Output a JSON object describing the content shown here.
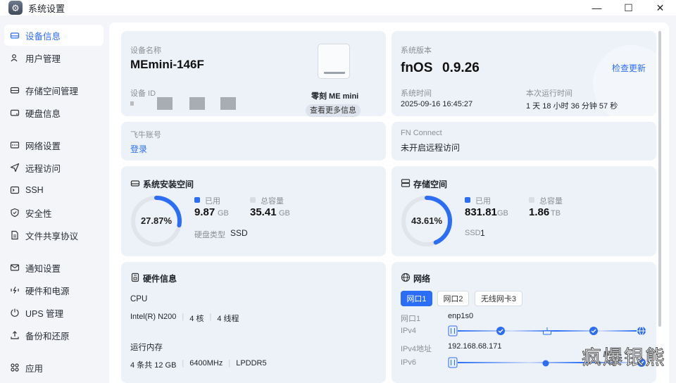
{
  "window": {
    "title": "系统设置",
    "controls": {
      "minimize": "—",
      "maximize": "☐",
      "close": "✕"
    }
  },
  "sidebar": {
    "items": [
      {
        "label": "设备信息",
        "icon": "hard-drive-icon",
        "active": true
      },
      {
        "label": "用户管理",
        "icon": "users-icon"
      },
      {
        "label": "存储空间管理",
        "icon": "storage-icon"
      },
      {
        "label": "硬盘信息",
        "icon": "disk-icon"
      },
      {
        "label": "网络设置",
        "icon": "network-icon"
      },
      {
        "label": "远程访问",
        "icon": "send-icon"
      },
      {
        "label": "SSH",
        "icon": "terminal-icon"
      },
      {
        "label": "安全性",
        "icon": "shield-icon"
      },
      {
        "label": "文件共享协议",
        "icon": "file-icon"
      },
      {
        "label": "通知设置",
        "icon": "mail-icon"
      },
      {
        "label": "硬件和电源",
        "icon": "power-icon"
      },
      {
        "label": "UPS 管理",
        "icon": "ups-icon"
      },
      {
        "label": "备份和还原",
        "icon": "backup-icon"
      },
      {
        "label": "应用",
        "icon": "apps-icon"
      }
    ]
  },
  "device": {
    "name_label": "设备名称",
    "name": "MEmini-146F",
    "id_label": "设备 ID",
    "model": "零刻 ME mini",
    "more_button": "查看更多信息"
  },
  "system": {
    "version_label": "系统版本",
    "os": "fnOS",
    "version": "0.9.26",
    "check_update": "检查更新",
    "time_label": "系统时间",
    "time": "2025-09-16 16:45:27",
    "uptime_label": "本次运行时间",
    "uptime": "1 天 18 小时 36 分钟 57 秒"
  },
  "account": {
    "label": "飞牛账号",
    "login": "登录"
  },
  "fnconnect": {
    "label": "FN Connect",
    "status": "未开启远程访问"
  },
  "system_space": {
    "title": "系统安装空间",
    "percent": "27.87%",
    "percent_value": 27.87,
    "used_label": "已用",
    "used": "9.87",
    "used_unit": "GB",
    "total_label": "总容量",
    "total": "35.41",
    "total_unit": "GB",
    "disk_type_label": "硬盘类型",
    "disk_type": "SSD"
  },
  "storage": {
    "title": "存储空间",
    "percent": "43.61%",
    "percent_value": 43.61,
    "used_label": "已用",
    "used": "831.81",
    "used_unit": "GB",
    "total_label": "总容量",
    "total": "1.86",
    "total_unit": "TB",
    "ssd_label": "SSD",
    "ssd_count": "1"
  },
  "hardware": {
    "title": "硬件信息",
    "cpu_label": "CPU",
    "cpu_model": "Intel(R) N200",
    "cpu_cores": "4 核",
    "cpu_threads": "4 线程",
    "ram_label": "运行内存",
    "ram_count": "4 条共 12 GB",
    "ram_speed": "6400MHz",
    "ram_type": "LPDDR5"
  },
  "network": {
    "title": "网络",
    "tabs": [
      "网口1",
      "网口2",
      "无线网卡3"
    ],
    "port_label": "网口1",
    "port_value": "enp1s0",
    "ipv4_label": "IPv4",
    "ipv4_addr_label": "IPv4地址",
    "ipv4_addr": "192.168.68.171",
    "ipv6_label": "IPv6"
  },
  "watermark": "疯爆银熊",
  "colors": {
    "accent": "#2b6ef5",
    "gauge_track": "#e1e5eb",
    "card": "#edf1f8"
  }
}
